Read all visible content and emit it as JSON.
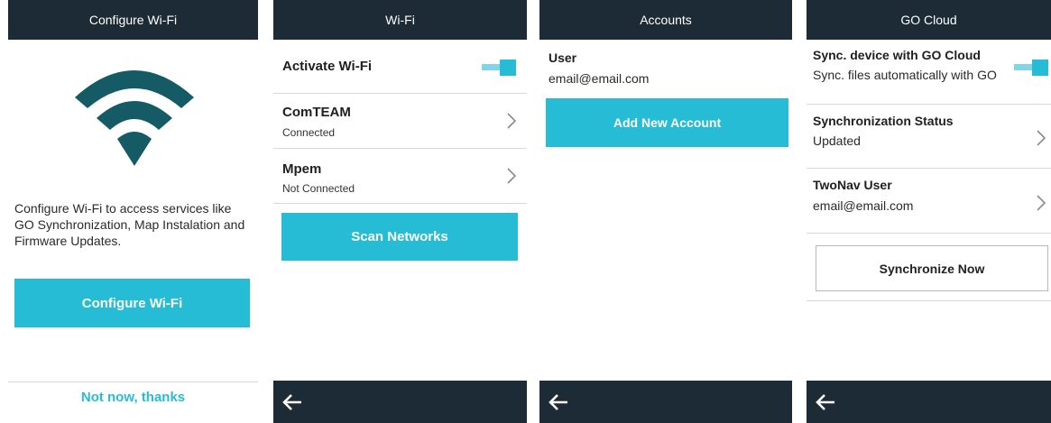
{
  "screen1": {
    "title": "Configure Wi-Fi",
    "description": "Configure Wi-Fi to access services like GO Synchronization, Map Instalation and Firmware Updates.",
    "configure_button": "Configure Wi-Fi",
    "not_now": "Not now, thanks",
    "wifi_icon": "wifi-icon"
  },
  "screen2": {
    "title": "Wi-Fi",
    "activate_label": "Activate Wi-Fi",
    "activate_on": true,
    "networks": [
      {
        "name": "ComTEAM",
        "status": "Connected"
      },
      {
        "name": "Mpem",
        "status": "Not Connected"
      }
    ],
    "scan_button": "Scan Networks"
  },
  "screen3": {
    "title": "Accounts",
    "user_label": "User",
    "user_email": "email@email.com",
    "add_button": "Add New Account"
  },
  "screen4": {
    "title": "GO Cloud",
    "sync_title": "Sync. device with GO Cloud",
    "sync_sub": "Sync. files automatically with GO",
    "sync_on": true,
    "status_title": "Synchronization Status",
    "status_value": "Updated",
    "user_title": "TwoNav User",
    "user_email": "email@email.com",
    "sync_now_button": "Synchronize Now"
  },
  "colors": {
    "header_bg": "#1c2b35",
    "accent": "#27bcd6",
    "wifi_icon": "#155b66"
  },
  "icons": {
    "back": "arrow-left-icon",
    "chevron": "chevron-right-icon",
    "wifi": "wifi-icon"
  }
}
